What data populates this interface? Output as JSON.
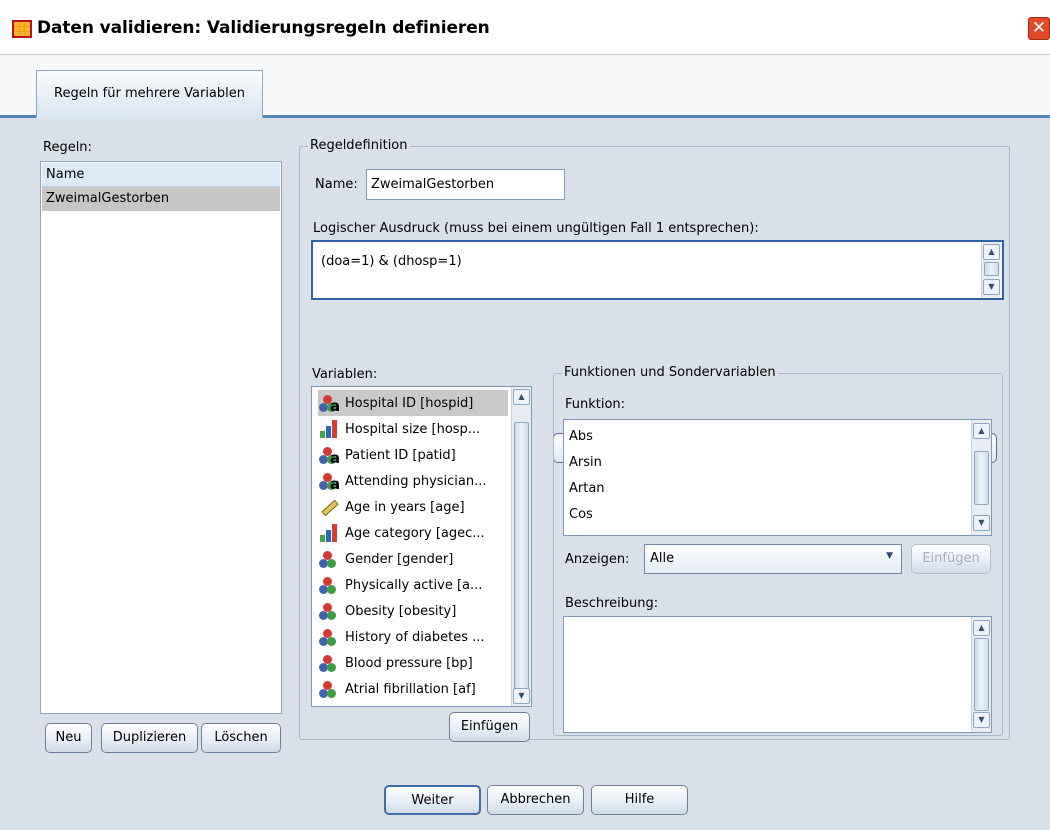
{
  "window": {
    "title": "Daten validieren: Validierungsregeln definieren",
    "close_symbol": "✕"
  },
  "tabs": [
    {
      "label": "Regeln für mehrere Variablen"
    }
  ],
  "rules": {
    "label": "Regeln:",
    "header": "Name",
    "items": [
      "ZweimalGestorben"
    ],
    "buttons": {
      "new": "Neu",
      "duplicate": "Duplizieren",
      "delete": "Löschen"
    }
  },
  "definition": {
    "group_label": "Regeldefinition",
    "name_label": "Name:",
    "name_value": "ZweimalGestorben",
    "expression_label": "Logischer Ausdruck (muss bei einem ungültigen Fall 1 entsprechen):",
    "expression_value": "(doa=1) & (dhosp=1)",
    "operators": [
      "+",
      "-",
      "*",
      "/",
      "**",
      "<",
      ">",
      "<=",
      ">=",
      "=",
      "~=",
      "&",
      "|",
      "~",
      "()"
    ]
  },
  "variables": {
    "label": "Variablen:",
    "items": [
      {
        "label": "Hospital ID [hospid]",
        "icon": "nominal-string"
      },
      {
        "label": "Hospital size [hosp...",
        "icon": "ordinal"
      },
      {
        "label": "Patient ID [patid]",
        "icon": "nominal-string"
      },
      {
        "label": "Attending physician...",
        "icon": "nominal-string"
      },
      {
        "label": "Age in years [age]",
        "icon": "scale"
      },
      {
        "label": "Age category [agec...",
        "icon": "ordinal"
      },
      {
        "label": "Gender [gender]",
        "icon": "nominal"
      },
      {
        "label": "Physically active [a...",
        "icon": "nominal"
      },
      {
        "label": "Obesity [obesity]",
        "icon": "nominal"
      },
      {
        "label": "History of diabetes ...",
        "icon": "nominal"
      },
      {
        "label": "Blood pressure [bp]",
        "icon": "nominal"
      },
      {
        "label": "Atrial fibrillation [af]",
        "icon": "nominal"
      }
    ],
    "insert_button": "Einfügen"
  },
  "functions": {
    "group_label": "Funktionen und Sondervariablen",
    "function_label": "Funktion:",
    "items": [
      "Abs",
      "Arsin",
      "Artan",
      "Cos"
    ],
    "show_label": "Anzeigen:",
    "show_value": "Alle",
    "insert_button": "Einfügen",
    "description_label": "Beschreibung:"
  },
  "footer": {
    "continue": "Weiter",
    "cancel": "Abbrechen",
    "help": "Hilfe"
  }
}
